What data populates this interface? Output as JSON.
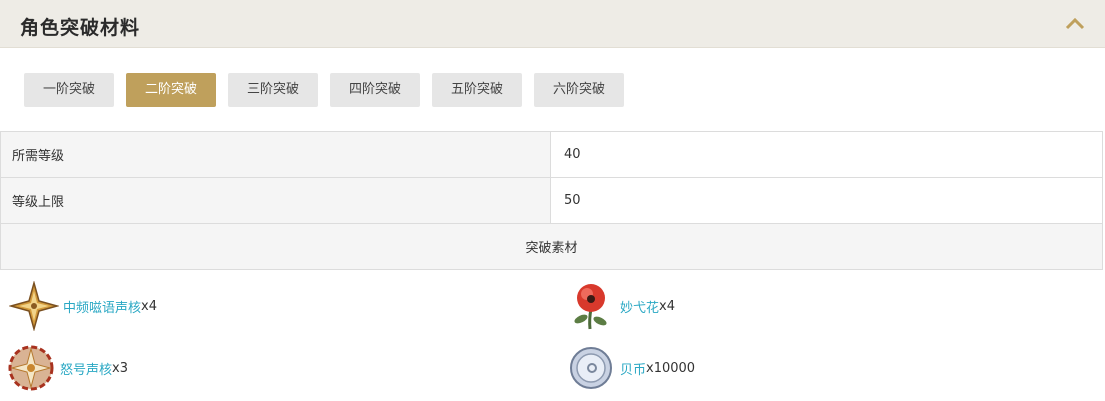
{
  "header": {
    "title": "角色突破材料"
  },
  "tabs": [
    "一阶突破",
    "二阶突破",
    "三阶突破",
    "四阶突破",
    "五阶突破",
    "六阶突破"
  ],
  "active_tab_index": 1,
  "table": {
    "rows": [
      {
        "label": "所需等级",
        "value": "40"
      },
      {
        "label": "等级上限",
        "value": "50"
      }
    ],
    "section_title": "突破素材"
  },
  "materials": [
    {
      "name": "中频嗞语声核",
      "qty": "x4",
      "icon": "shuriken-core-icon"
    },
    {
      "name": "妙弋花",
      "qty": "x4",
      "icon": "red-flower-icon"
    },
    {
      "name": "怒号声核",
      "qty": "x3",
      "icon": "howler-core-icon"
    },
    {
      "name": "贝币",
      "qty": "x10000",
      "icon": "shell-coin-icon"
    }
  ],
  "colors": {
    "accent": "#bfa05c",
    "link": "#2aa8c4",
    "header_bg": "#eeece6"
  }
}
